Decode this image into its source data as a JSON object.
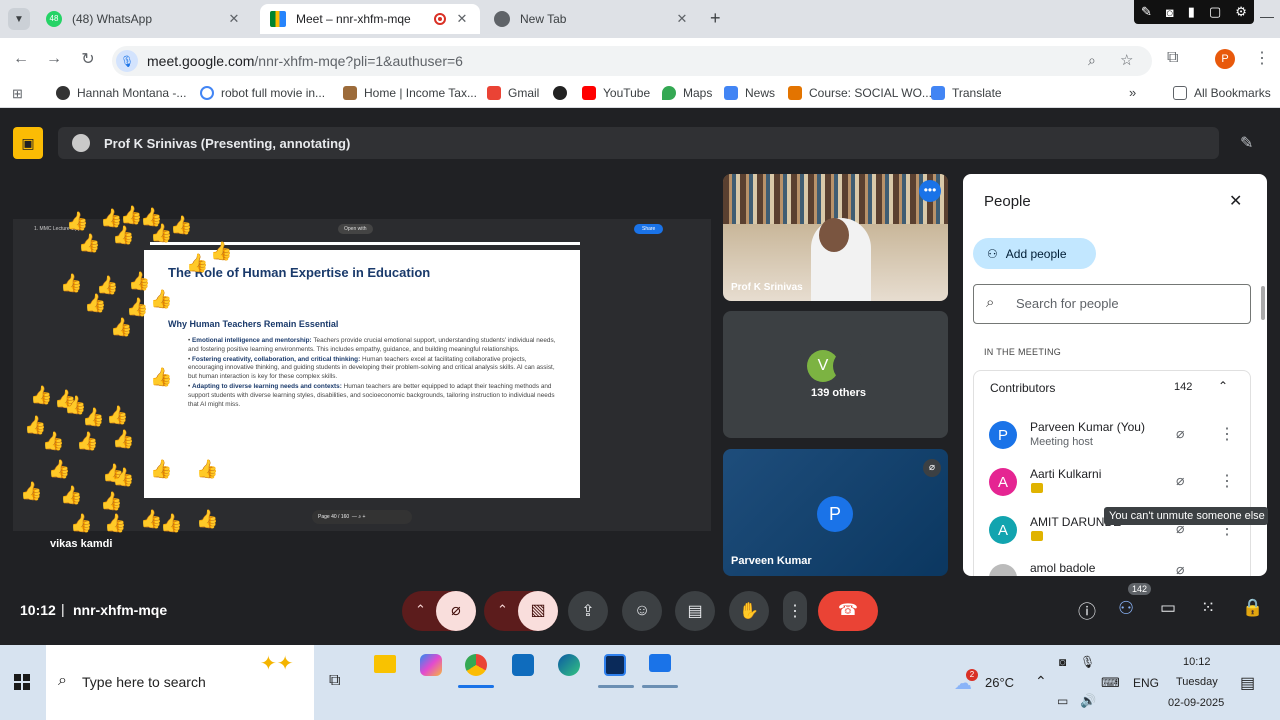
{
  "tabs": [
    {
      "title": "(48) WhatsApp",
      "badge": "48",
      "active": false
    },
    {
      "title": "Meet – nnr-xhfm-mqe",
      "active": true
    },
    {
      "title": "New Tab",
      "active": false
    }
  ],
  "toolbar": {
    "url_host": "meet.google.com",
    "url_path": "/nnr-xhfm-mqe?pli=1&authuser=6",
    "profile_initial": "P"
  },
  "bookmarks": [
    {
      "label": "Hannah Montana -...",
      "icon": "music-icon"
    },
    {
      "label": "robot full movie in...",
      "icon": "google-icon"
    },
    {
      "label": "Home | Income Tax...",
      "icon": "income-tax-icon"
    },
    {
      "label": "Gmail",
      "icon": "gmail-icon"
    },
    {
      "label": "",
      "icon": "globe-icon"
    },
    {
      "label": "YouTube",
      "icon": "youtube-icon"
    },
    {
      "label": "Maps",
      "icon": "maps-icon"
    },
    {
      "label": "News",
      "icon": "news-icon"
    },
    {
      "label": "Course: SOCIAL WO...",
      "icon": "course-icon"
    },
    {
      "label": "Translate",
      "icon": "translate-icon"
    }
  ],
  "bookmarks_all": "All Bookmarks",
  "meet": {
    "presenting_banner": "Prof K Srinivas (Presenting, annotating)",
    "presenter_tile_name": "vikas kamdi",
    "slide": {
      "file_label": "1. MMC Lecture 1.ppt",
      "open_with": "Open with",
      "share": "Share",
      "title": "The Role of Human Expertise in Education",
      "subtitle": "Why Human Teachers Remain Essential",
      "bullets": [
        {
          "bold": "Emotional intelligence and mentorship:",
          "text": " Teachers provide crucial emotional support, understanding students' individual needs, and fostering positive learning environments. This includes empathy, guidance, and building meaningful relationships."
        },
        {
          "bold": "Fostering creativity, collaboration, and critical thinking:",
          "text": " Human teachers excel at facilitating collaborative projects, encouraging innovative thinking, and guiding students in developing their problem-solving and critical analysis skills. AI can assist, but human interaction is key for these complex skills."
        },
        {
          "bold": "Adapting to diverse learning needs and contexts:",
          "text": " Human teachers are better equipped to adapt their teaching methods and support students with diverse learning styles, disabilities, and socioeconomic backgrounds, tailoring instruction to individual needs that AI might miss."
        }
      ],
      "page_label": "Page",
      "page_current": "40",
      "page_total": "160"
    },
    "tiles": {
      "speaker_name": "Prof K Srinivas",
      "others_initial": "V",
      "others_label": "139 others",
      "self_initial": "P",
      "self_name": "Parveen Kumar"
    },
    "people_panel": {
      "title": "People",
      "add_people": "Add people",
      "search_placeholder": "Search for people",
      "section": "IN THE MEETING",
      "group_label": "Contributors",
      "group_count": "142",
      "rows": [
        {
          "initial": "P",
          "name": "Parveen Kumar (You)",
          "sub": "Meeting host",
          "color": "#1a73e8"
        },
        {
          "initial": "A",
          "name": "Aarti Kulkarni",
          "sub": "",
          "color": "#e52592"
        },
        {
          "initial": "A",
          "name": "AMIT DARUNDE",
          "sub": "",
          "color": "#12a4af"
        },
        {
          "initial": "",
          "name": "amol badole",
          "sub": "",
          "color": "#888888"
        }
      ],
      "tooltip": "You can't unmute someone else"
    },
    "bottom": {
      "time": "10:12",
      "meeting_code": "nnr-xhfm-mqe",
      "people_count": "142"
    }
  },
  "taskbar": {
    "search_placeholder": "Type here to search",
    "weather": "26°C",
    "weather_alert": "2",
    "lang": "ENG",
    "time": "10:12",
    "day": "Tuesday",
    "date": "02-09-2025"
  }
}
